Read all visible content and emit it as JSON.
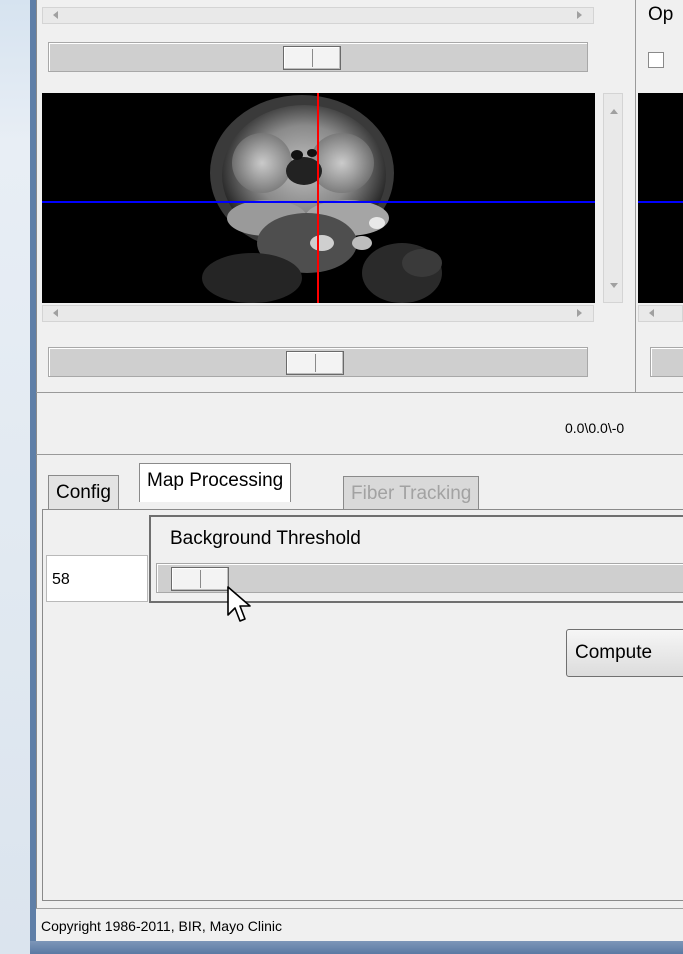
{
  "top_panel": {
    "option_label_partial": "Op"
  },
  "status_bar": {
    "coordinates": "0.0\\0.0\\-0"
  },
  "tabs": [
    {
      "label": "Config",
      "state": "normal"
    },
    {
      "label": "Map Processing",
      "state": "active"
    },
    {
      "label": "Fiber Tracking",
      "state": "disabled"
    }
  ],
  "background_threshold": {
    "label": "Background Threshold",
    "value": "58"
  },
  "compute_button": {
    "label": "Compute"
  },
  "footer": {
    "copyright": "Copyright 1986-2011, BIR, Mayo Clinic"
  },
  "colors": {
    "crosshair_horizontal": "#0000ff",
    "crosshair_vertical": "#ff0000",
    "window_frame": "#5f7fa7"
  },
  "icons": [
    "cursor-arrow-icon",
    "scroll-left-icon",
    "scroll-right-icon",
    "scroll-up-icon",
    "scroll-down-icon"
  ]
}
